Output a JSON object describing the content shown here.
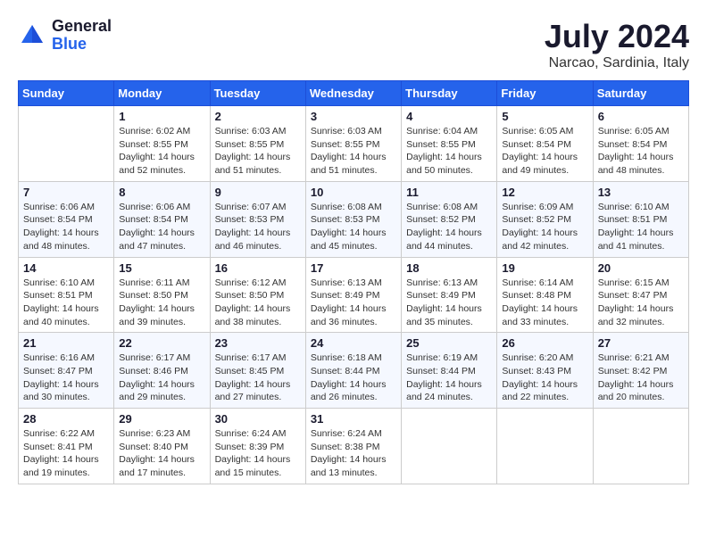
{
  "logo": {
    "general": "General",
    "blue": "Blue"
  },
  "title": {
    "month_year": "July 2024",
    "location": "Narcao, Sardinia, Italy"
  },
  "calendar": {
    "headers": [
      "Sunday",
      "Monday",
      "Tuesday",
      "Wednesday",
      "Thursday",
      "Friday",
      "Saturday"
    ],
    "weeks": [
      [
        {
          "day": "",
          "content": ""
        },
        {
          "day": "1",
          "content": "Sunrise: 6:02 AM\nSunset: 8:55 PM\nDaylight: 14 hours\nand 52 minutes."
        },
        {
          "day": "2",
          "content": "Sunrise: 6:03 AM\nSunset: 8:55 PM\nDaylight: 14 hours\nand 51 minutes."
        },
        {
          "day": "3",
          "content": "Sunrise: 6:03 AM\nSunset: 8:55 PM\nDaylight: 14 hours\nand 51 minutes."
        },
        {
          "day": "4",
          "content": "Sunrise: 6:04 AM\nSunset: 8:55 PM\nDaylight: 14 hours\nand 50 minutes."
        },
        {
          "day": "5",
          "content": "Sunrise: 6:05 AM\nSunset: 8:54 PM\nDaylight: 14 hours\nand 49 minutes."
        },
        {
          "day": "6",
          "content": "Sunrise: 6:05 AM\nSunset: 8:54 PM\nDaylight: 14 hours\nand 48 minutes."
        }
      ],
      [
        {
          "day": "7",
          "content": "Sunrise: 6:06 AM\nSunset: 8:54 PM\nDaylight: 14 hours\nand 48 minutes."
        },
        {
          "day": "8",
          "content": "Sunrise: 6:06 AM\nSunset: 8:54 PM\nDaylight: 14 hours\nand 47 minutes."
        },
        {
          "day": "9",
          "content": "Sunrise: 6:07 AM\nSunset: 8:53 PM\nDaylight: 14 hours\nand 46 minutes."
        },
        {
          "day": "10",
          "content": "Sunrise: 6:08 AM\nSunset: 8:53 PM\nDaylight: 14 hours\nand 45 minutes."
        },
        {
          "day": "11",
          "content": "Sunrise: 6:08 AM\nSunset: 8:52 PM\nDaylight: 14 hours\nand 44 minutes."
        },
        {
          "day": "12",
          "content": "Sunrise: 6:09 AM\nSunset: 8:52 PM\nDaylight: 14 hours\nand 42 minutes."
        },
        {
          "day": "13",
          "content": "Sunrise: 6:10 AM\nSunset: 8:51 PM\nDaylight: 14 hours\nand 41 minutes."
        }
      ],
      [
        {
          "day": "14",
          "content": "Sunrise: 6:10 AM\nSunset: 8:51 PM\nDaylight: 14 hours\nand 40 minutes."
        },
        {
          "day": "15",
          "content": "Sunrise: 6:11 AM\nSunset: 8:50 PM\nDaylight: 14 hours\nand 39 minutes."
        },
        {
          "day": "16",
          "content": "Sunrise: 6:12 AM\nSunset: 8:50 PM\nDaylight: 14 hours\nand 38 minutes."
        },
        {
          "day": "17",
          "content": "Sunrise: 6:13 AM\nSunset: 8:49 PM\nDaylight: 14 hours\nand 36 minutes."
        },
        {
          "day": "18",
          "content": "Sunrise: 6:13 AM\nSunset: 8:49 PM\nDaylight: 14 hours\nand 35 minutes."
        },
        {
          "day": "19",
          "content": "Sunrise: 6:14 AM\nSunset: 8:48 PM\nDaylight: 14 hours\nand 33 minutes."
        },
        {
          "day": "20",
          "content": "Sunrise: 6:15 AM\nSunset: 8:47 PM\nDaylight: 14 hours\nand 32 minutes."
        }
      ],
      [
        {
          "day": "21",
          "content": "Sunrise: 6:16 AM\nSunset: 8:47 PM\nDaylight: 14 hours\nand 30 minutes."
        },
        {
          "day": "22",
          "content": "Sunrise: 6:17 AM\nSunset: 8:46 PM\nDaylight: 14 hours\nand 29 minutes."
        },
        {
          "day": "23",
          "content": "Sunrise: 6:17 AM\nSunset: 8:45 PM\nDaylight: 14 hours\nand 27 minutes."
        },
        {
          "day": "24",
          "content": "Sunrise: 6:18 AM\nSunset: 8:44 PM\nDaylight: 14 hours\nand 26 minutes."
        },
        {
          "day": "25",
          "content": "Sunrise: 6:19 AM\nSunset: 8:44 PM\nDaylight: 14 hours\nand 24 minutes."
        },
        {
          "day": "26",
          "content": "Sunrise: 6:20 AM\nSunset: 8:43 PM\nDaylight: 14 hours\nand 22 minutes."
        },
        {
          "day": "27",
          "content": "Sunrise: 6:21 AM\nSunset: 8:42 PM\nDaylight: 14 hours\nand 20 minutes."
        }
      ],
      [
        {
          "day": "28",
          "content": "Sunrise: 6:22 AM\nSunset: 8:41 PM\nDaylight: 14 hours\nand 19 minutes."
        },
        {
          "day": "29",
          "content": "Sunrise: 6:23 AM\nSunset: 8:40 PM\nDaylight: 14 hours\nand 17 minutes."
        },
        {
          "day": "30",
          "content": "Sunrise: 6:24 AM\nSunset: 8:39 PM\nDaylight: 14 hours\nand 15 minutes."
        },
        {
          "day": "31",
          "content": "Sunrise: 6:24 AM\nSunset: 8:38 PM\nDaylight: 14 hours\nand 13 minutes."
        },
        {
          "day": "",
          "content": ""
        },
        {
          "day": "",
          "content": ""
        },
        {
          "day": "",
          "content": ""
        }
      ]
    ]
  }
}
